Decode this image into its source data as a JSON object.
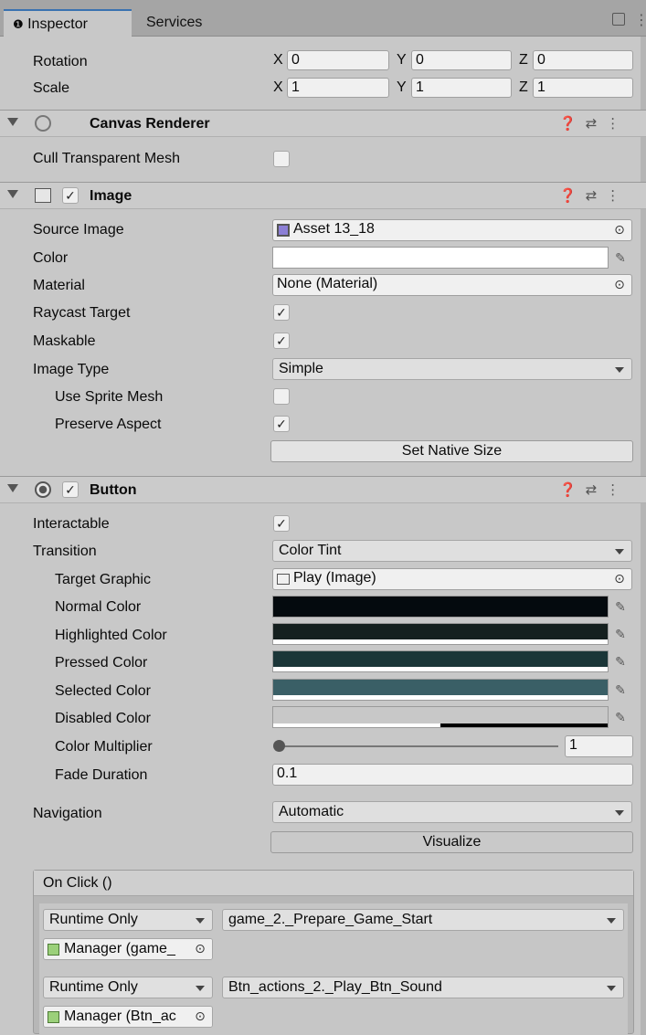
{
  "tabs": {
    "inspector": "Inspector",
    "services": "Services",
    "info_glyph": "❶"
  },
  "transform": {
    "rotation": {
      "label": "Rotation",
      "x": "0",
      "y": "0",
      "z": "0"
    },
    "scale": {
      "label": "Scale",
      "x": "1",
      "y": "1",
      "z": "1"
    },
    "axis": {
      "x": "X",
      "y": "Y",
      "z": "Z"
    }
  },
  "canvas_renderer": {
    "title": "Canvas Renderer",
    "cull_label": "Cull Transparent Mesh",
    "cull_checked": ""
  },
  "image": {
    "title": "Image",
    "enabled": "✓",
    "source_label": "Source Image",
    "source_value": "Asset 13_18",
    "color_label": "Color",
    "material_label": "Material",
    "material_value": "None (Material)",
    "raycast_label": "Raycast Target",
    "raycast_checked": "✓",
    "maskable_label": "Maskable",
    "maskable_checked": "✓",
    "type_label": "Image Type",
    "type_value": "Simple",
    "sprite_mesh_label": "Use Sprite Mesh",
    "sprite_mesh_checked": "",
    "preserve_label": "Preserve Aspect",
    "preserve_checked": "✓",
    "native_button": "Set Native Size"
  },
  "button": {
    "title": "Button",
    "enabled": "✓",
    "interactable_label": "Interactable",
    "interactable_checked": "✓",
    "transition_label": "Transition",
    "transition_value": "Color Tint",
    "target_label": "Target Graphic",
    "target_value": "Play (Image)",
    "normal_label": "Normal Color",
    "highlighted_label": "Highlighted Color",
    "pressed_label": "Pressed Color",
    "selected_label": "Selected Color",
    "disabled_label": "Disabled Color",
    "multiplier_label": "Color Multiplier",
    "multiplier_value": "1",
    "fade_label": "Fade Duration",
    "fade_value": "0.1",
    "navigation_label": "Navigation",
    "navigation_value": "Automatic",
    "visualize_button": "Visualize",
    "colors": {
      "normal": "#040a0e",
      "highlighted": "#15201f",
      "pressed": "#1b3638",
      "selected": "#3a5f66",
      "disabled": "#c8c8c8"
    }
  },
  "on_click": {
    "title": "On Click ()",
    "entries": [
      {
        "mode": "Runtime Only",
        "function": "game_2._Prepare_Game_Start",
        "object": "Manager (game_"
      },
      {
        "mode": "Runtime Only",
        "function": "Btn_actions_2._Play_Btn_Sound",
        "object": "Manager (Btn_ac"
      }
    ]
  },
  "icons": {
    "help": "❓",
    "preset": "⇄",
    "menu": "⋮",
    "lock": "🔒",
    "object_picker": "⊙",
    "eyedropper": "✎"
  }
}
